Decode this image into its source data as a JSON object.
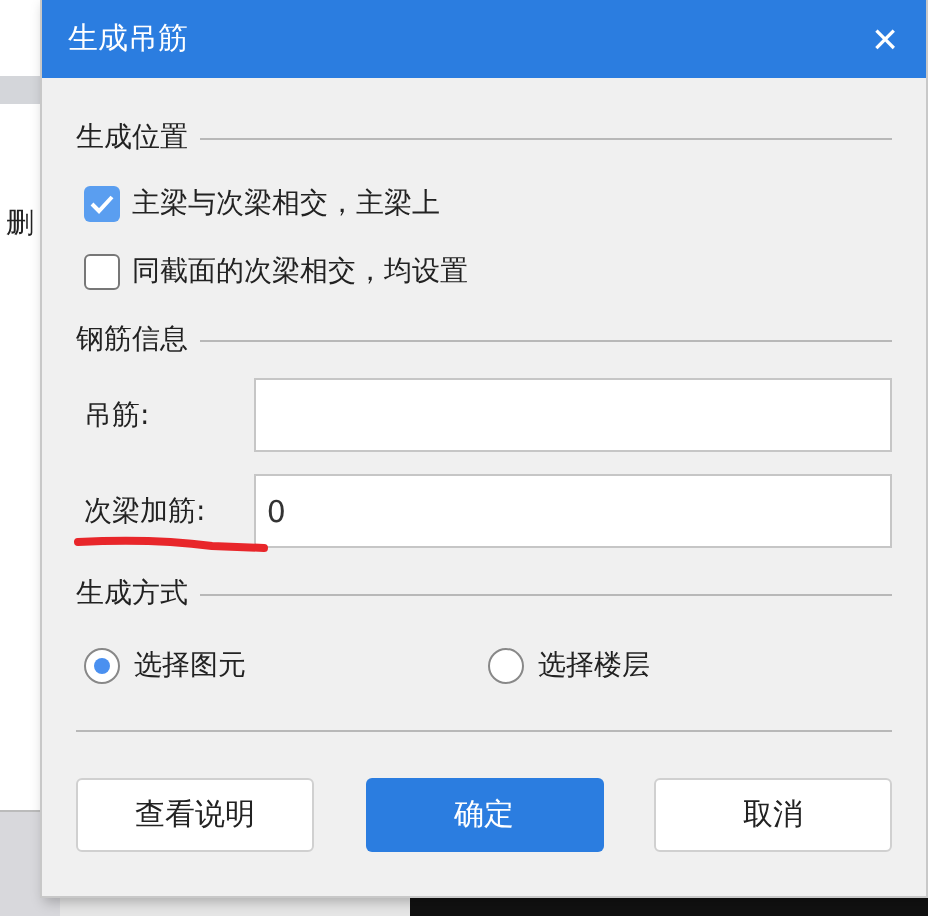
{
  "background": {
    "toolbar_text": "删"
  },
  "dialog": {
    "title": "生成吊筋",
    "close": "×",
    "sections": [
      {
        "kind": "checks",
        "title": "生成位置",
        "items": [
          {
            "label": "主梁与次梁相交，主梁上",
            "checked": true
          },
          {
            "label": "同截面的次梁相交，均设置",
            "checked": false
          }
        ]
      },
      {
        "kind": "fields",
        "title": "钢筋信息",
        "items": [
          {
            "label": "吊筋:",
            "value": "",
            "annotated": false
          },
          {
            "label": "次梁加筋:",
            "value": "0",
            "annotated": true
          }
        ]
      },
      {
        "kind": "radios",
        "title": "生成方式",
        "items": [
          {
            "label": "选择图元",
            "selected": true
          },
          {
            "label": "选择楼层",
            "selected": false
          }
        ]
      }
    ],
    "buttons": [
      {
        "label": "查看说明",
        "primary": false
      },
      {
        "label": "确定",
        "primary": true
      },
      {
        "label": "取消",
        "primary": false
      }
    ]
  }
}
